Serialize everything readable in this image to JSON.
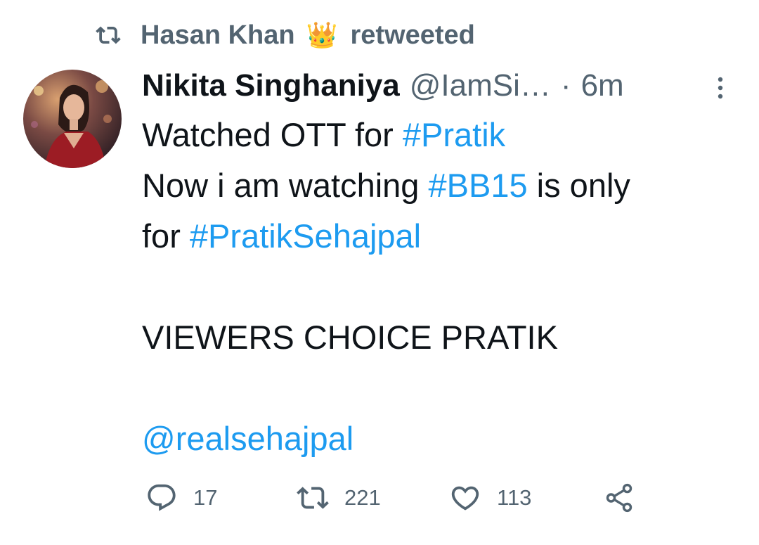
{
  "retweet_banner": {
    "retweeter_name": "Hasan Khan",
    "crown_emoji": "👑",
    "action_text": "retweeted"
  },
  "tweet": {
    "display_name": "Nikita Singhaniya",
    "handle": "@IamSi…",
    "separator": "·",
    "timestamp": "6m",
    "lines": [
      {
        "parts": [
          {
            "text": "Watched OTT for "
          },
          {
            "link": "#Pratik"
          }
        ]
      },
      {
        "parts": [
          {
            "text": "Now i am watching "
          },
          {
            "link": "#BB15"
          },
          {
            "text": " is only"
          }
        ]
      },
      {
        "parts": [
          {
            "text": "for "
          },
          {
            "link": "#PratikSehajpal"
          }
        ]
      },
      {
        "parts": [
          {
            "text": "VIEWERS CHOICE PRATIK"
          }
        ]
      },
      {
        "parts": [
          {
            "link": "@realsehajpal"
          }
        ]
      }
    ]
  },
  "actions": {
    "reply_count": "17",
    "retweet_count": "221",
    "like_count": "113"
  },
  "colors": {
    "link": "#1d9bf0",
    "muted": "#536471",
    "text": "#0f1419"
  }
}
